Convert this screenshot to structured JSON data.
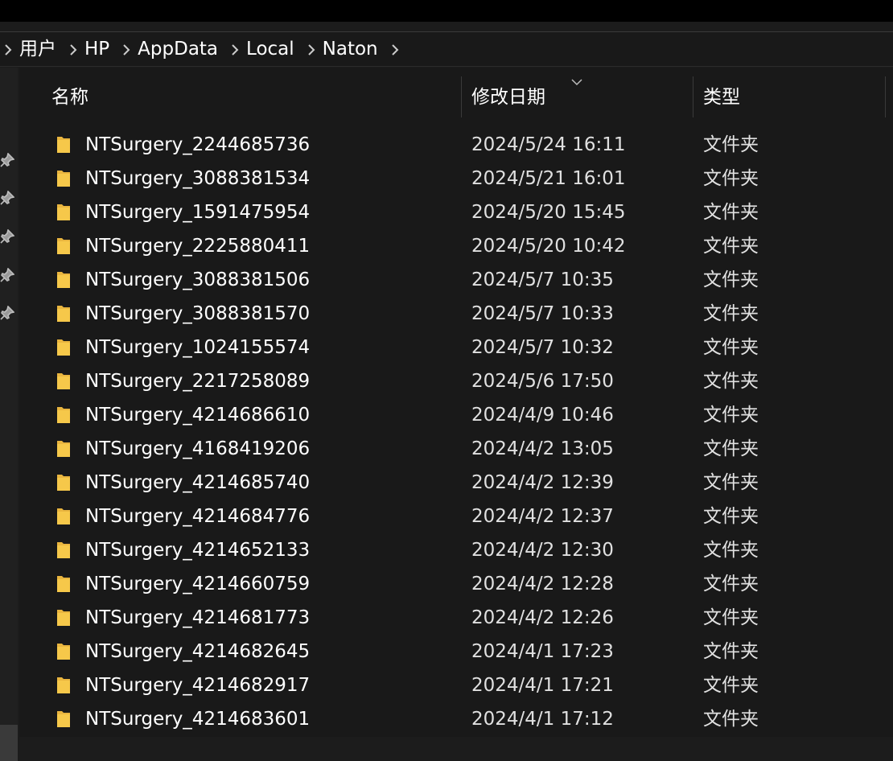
{
  "breadcrumb": {
    "items": [
      {
        "label": "用户"
      },
      {
        "label": "HP"
      },
      {
        "label": "AppData"
      },
      {
        "label": "Local"
      },
      {
        "label": "Naton"
      }
    ],
    "separator_icon": "chevron-right-icon"
  },
  "columns": {
    "name": "名称",
    "modified": "修改日期",
    "type": "类型",
    "sorted_by": "修改日期",
    "sort_direction": "descending"
  },
  "files": [
    {
      "name": "NTSurgery_2244685736",
      "modified": "2024/5/24 16:11",
      "type": "文件夹"
    },
    {
      "name": "NTSurgery_3088381534",
      "modified": "2024/5/21 16:01",
      "type": "文件夹"
    },
    {
      "name": "NTSurgery_1591475954",
      "modified": "2024/5/20 15:45",
      "type": "文件夹"
    },
    {
      "name": "NTSurgery_2225880411",
      "modified": "2024/5/20 10:42",
      "type": "文件夹"
    },
    {
      "name": "NTSurgery_3088381506",
      "modified": "2024/5/7 10:35",
      "type": "文件夹"
    },
    {
      "name": "NTSurgery_3088381570",
      "modified": "2024/5/7 10:33",
      "type": "文件夹"
    },
    {
      "name": "NTSurgery_1024155574",
      "modified": "2024/5/7 10:32",
      "type": "文件夹"
    },
    {
      "name": "NTSurgery_2217258089",
      "modified": "2024/5/6 17:50",
      "type": "文件夹"
    },
    {
      "name": "NTSurgery_4214686610",
      "modified": "2024/4/9 10:46",
      "type": "文件夹"
    },
    {
      "name": "NTSurgery_4168419206",
      "modified": "2024/4/2 13:05",
      "type": "文件夹"
    },
    {
      "name": "NTSurgery_4214685740",
      "modified": "2024/4/2 12:39",
      "type": "文件夹"
    },
    {
      "name": "NTSurgery_4214684776",
      "modified": "2024/4/2 12:37",
      "type": "文件夹"
    },
    {
      "name": "NTSurgery_4214652133",
      "modified": "2024/4/2 12:30",
      "type": "文件夹"
    },
    {
      "name": "NTSurgery_4214660759",
      "modified": "2024/4/2 12:28",
      "type": "文件夹"
    },
    {
      "name": "NTSurgery_4214681773",
      "modified": "2024/4/2 12:26",
      "type": "文件夹"
    },
    {
      "name": "NTSurgery_4214682645",
      "modified": "2024/4/1 17:23",
      "type": "文件夹"
    },
    {
      "name": "NTSurgery_4214682917",
      "modified": "2024/4/1 17:21",
      "type": "文件夹"
    },
    {
      "name": "NTSurgery_4214683601",
      "modified": "2024/4/1 17:12",
      "type": "文件夹"
    }
  ],
  "sidebar": {
    "pinned_icons": [
      "pin-icon",
      "pin-icon",
      "pin-icon",
      "pin-icon",
      "pin-icon"
    ]
  },
  "colors": {
    "background": "#191919",
    "folder": "#f6c84a",
    "text": "#ffffff",
    "separator": "#3a3a3a"
  }
}
